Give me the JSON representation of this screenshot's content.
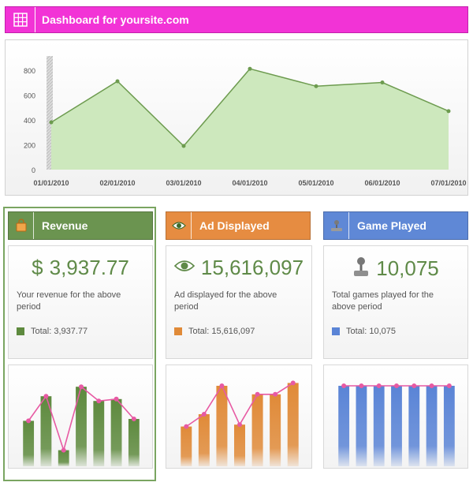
{
  "header": {
    "title": "Dashboard for yoursite.com",
    "icon": "grid-icon",
    "color": "#f233d6"
  },
  "main_chart": {
    "chart_data": {
      "type": "area",
      "categories": [
        "01/01/2010",
        "02/01/2010",
        "03/01/2010",
        "04/01/2010",
        "05/01/2010",
        "06/01/2010",
        "07/01/2010"
      ],
      "x_tick_positions": [
        0,
        1,
        2,
        3,
        4,
        5,
        6
      ],
      "series": [
        {
          "x": [
            0,
            1,
            2,
            3,
            4,
            5,
            6
          ],
          "values": [
            380,
            710,
            190,
            810,
            670,
            700,
            470
          ]
        }
      ],
      "yticks": [
        "0",
        "200",
        "400",
        "600",
        "800"
      ],
      "ylim": [
        0,
        900
      ],
      "title": "",
      "xlabel": "",
      "ylabel": "",
      "grid": false,
      "fill_color": "#cde8bd",
      "line_color": "#6d9b4f"
    }
  },
  "panels": [
    {
      "tab_label": "Revenue",
      "tab_icon": "bag-icon",
      "color": "#6b9450",
      "value_icon": "dollar-sign",
      "value_prefix": "$",
      "value": "3,937.77",
      "description": "Your revenue for the above period",
      "total_label": "Total: 3,937.77",
      "chart_data": {
        "type": "bar",
        "values": [
          48,
          74,
          17,
          84,
          69,
          71,
          50
        ],
        "line_values": [
          48,
          74,
          17,
          84,
          69,
          71,
          50
        ],
        "ylim": [
          0,
          100
        ],
        "bar_color": "#5e8a3e",
        "line_color": "#e75aa3"
      }
    },
    {
      "tab_label": "Ad Displayed",
      "tab_icon": "eye-icon",
      "color": "#e68c41",
      "value_icon": "eye-icon",
      "value": "15,616,097",
      "description": "Ad  displayed for the above period",
      "total_label": "Total: 15,616,097",
      "chart_data": {
        "type": "bar",
        "values": [
          42,
          55,
          85,
          44,
          76,
          76,
          88
        ],
        "line_values": [
          42,
          55,
          85,
          44,
          76,
          76,
          88
        ],
        "ylim": [
          0,
          100
        ],
        "bar_color": "#e08a38",
        "line_color": "#e75aa3"
      }
    },
    {
      "tab_label": "Game Played",
      "tab_icon": "joystick-icon",
      "color": "#5f88d6",
      "value_icon": "joystick-icon",
      "value": "10,075",
      "description": "Total games played for the above period",
      "total_label": "Total: 10,075",
      "chart_data": {
        "type": "bar",
        "values": [
          85,
          85,
          85,
          85,
          85,
          85,
          85
        ],
        "line_values": [
          85,
          85,
          85,
          85,
          85,
          85,
          85
        ],
        "ylim": [
          0,
          100
        ],
        "bar_color": "#5a84d6",
        "line_color": "#e75aa3"
      }
    }
  ]
}
